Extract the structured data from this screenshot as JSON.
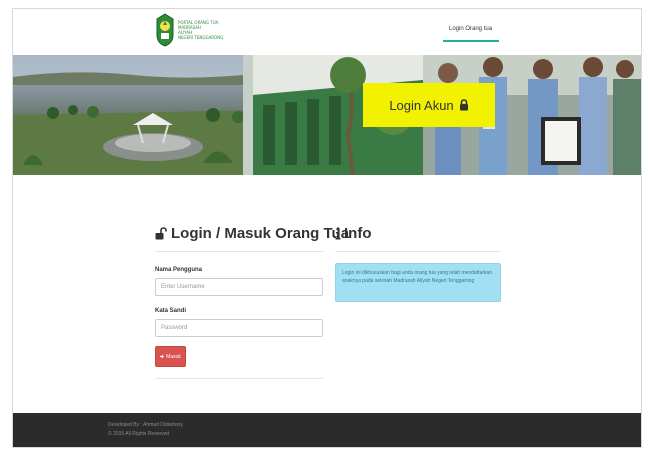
{
  "navbar": {
    "logo_lines": [
      "PORTAL ORANG TUA",
      "MADRASAH",
      "ALIYAH",
      "NEGERI TENGGARONG"
    ],
    "login_link": "Login Orang tua"
  },
  "banner": {
    "cta_label": "Login Akun"
  },
  "login": {
    "title": "Login / Masuk Orang Tua",
    "username_label": "Nama Pengguna",
    "username_placeholder": "Enter Username",
    "password_label": "Kata Sandi",
    "password_placeholder": "Password",
    "submit_label": "Masuk"
  },
  "info": {
    "title": "Info",
    "message": "Login ini dikhususkan bagi anda orang tua yang telah mendaftarkan anaknya pada sekolah Madrasah Aliyah Negeri Tenggarong"
  },
  "footer": {
    "developer": "Developed By : Ahmad Didiartony",
    "copyright": "© 2015 All Rights Reserved"
  },
  "colors": {
    "accent": "#1ab394",
    "cta_yellow": "#f2f200",
    "button_red": "#d9534f",
    "info_blue": "#a3dff2",
    "footer_bg": "#2b2b2b"
  },
  "icons": [
    "school-emblem-icon",
    "lock-icon",
    "unlock-icon",
    "info-icon",
    "sign-in-icon"
  ]
}
